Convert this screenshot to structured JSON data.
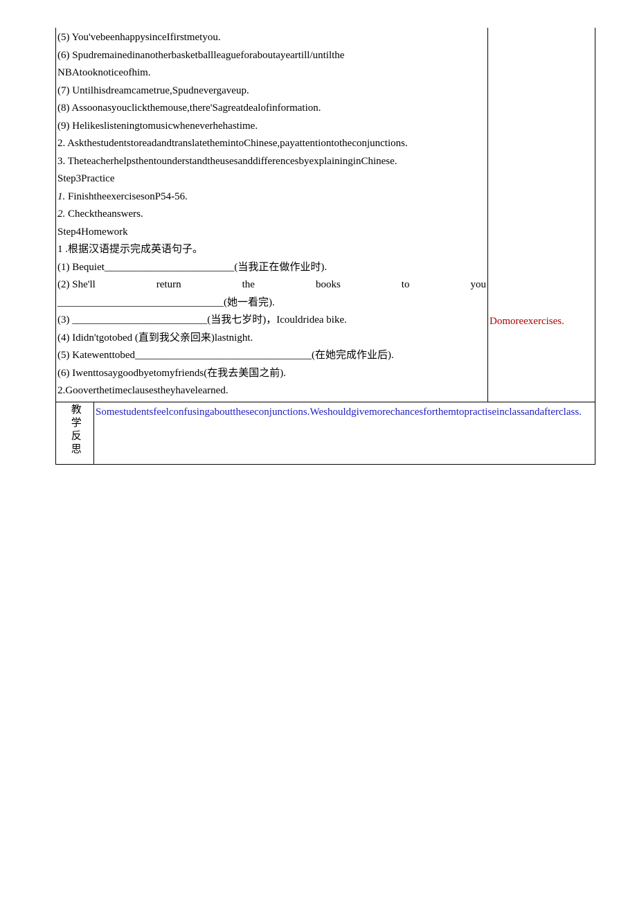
{
  "main": {
    "l1": "(5) You'vebeenhappysinceIfirstmetyou.",
    "l2": "(6) Spudremainedinanotherbasketballleagueforaboutayeartill/untilthe",
    "l3": "NBAtooknoticeofhim.",
    "l4": "(7) Untilhisdreamcametrue,Spudnevergaveup.",
    "l5": "(8) Assoonasyouclickthemouse,there'Sagreatdealofinformation.",
    "l6": "(9) Helikeslisteningtomusicwheneverhehastime.",
    "l7": "2. AskthestudentstoreadandtranslatethemintoChinese,payattentiontotheconjunctions.",
    "l8": "3. TheteacherhelpsthentounderstandtheusesanddifferencesbyexplaininginChinese.",
    "l9": "Step3Practice",
    "l10a": "1.",
    "l10b": " FinishtheexercisesonP54-56.",
    "l11a": "2.",
    "l11b": " Checktheanswers.",
    "l12": "Step4Homework",
    "l13": "1      .根据汉语提示完成英语句子。",
    "l14": "(1) Bequiet_________________________(当我正在做作业时).",
    "l15a": "(2) She'll",
    "l15b": "return",
    "l15c": "the",
    "l15d": "books",
    "l15e": "to",
    "l15f": "you",
    "l16": "________________________________(她一看完).",
    "l17": "(3) __________________________(当我七岁时)，Icouldridea bike.",
    "l18": "(4) Ididn'tgotobed                               (直到我父亲回来)lastnight.",
    "l19": "(5) Katewenttobed__________________________________(在她完成作业后).",
    "l20": "(6) Iwenttosaygoodbyetomyfriends(在我去美国之前).",
    "l21": "2.Gooverthetimeclausestheyhavelearned."
  },
  "side": {
    "note": "Domoreexercises."
  },
  "reflection": {
    "label": "教学反思",
    "text": "Somestudentsfeelconfusingabouttheseconjunctions.Weshouldgivemorechancesforthemtopractiseinclassandafterclass."
  }
}
